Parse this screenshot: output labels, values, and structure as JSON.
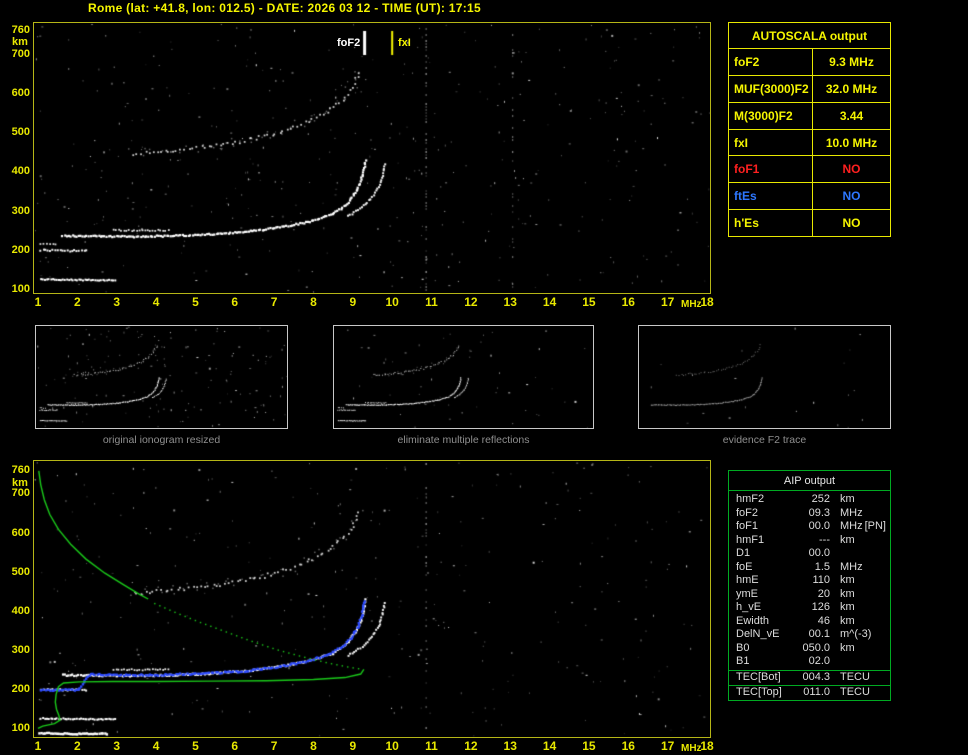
{
  "title": "Rome (lat: +41.8, lon: 012.5) - DATE: 2026 03 12 - TIME (UT): 17:15",
  "top_plot": {
    "fof2_label": "foF2",
    "fxi_label": "fxI",
    "y_unit": "km",
    "x_unit": "MHz"
  },
  "bottom_plot": {
    "y_unit": "km",
    "x_unit": "MHz"
  },
  "autoscala_table": {
    "title": "AUTOSCALA output",
    "rows": [
      {
        "label": "foF2",
        "value": "9.3 MHz",
        "color": "#f5f500"
      },
      {
        "label": "MUF(3000)F2",
        "value": "32.0 MHz",
        "color": "#f5f500"
      },
      {
        "label": "M(3000)F2",
        "value": "3.44",
        "color": "#f5f500"
      },
      {
        "label": "fxI",
        "value": "10.0 MHz",
        "color": "#f5f500"
      },
      {
        "label": "foF1",
        "value": "NO",
        "color": "#ff2020"
      },
      {
        "label": "ftEs",
        "value": "NO",
        "color": "#2e78ff"
      },
      {
        "label": "h'Es",
        "value": "NO",
        "color": "#f5f500"
      }
    ]
  },
  "thumbnails": [
    {
      "caption": "original ionogram resized",
      "noise_seed": 31,
      "noise_count": 150,
      "alpha": 1
    },
    {
      "caption": "eliminate multiple reflections",
      "noise_seed": 32,
      "noise_count": 55,
      "alpha": 1
    },
    {
      "caption": "evidence F2 trace",
      "noise_seed": 33,
      "noise_count": 20,
      "alpha": 0.55,
      "series": [
        "F2-trace-O",
        "second-hop"
      ]
    }
  ],
  "aip_table": {
    "title": "AIP output",
    "rows": [
      {
        "name": "hmF2",
        "value": "252",
        "unit": "km",
        "extra": ""
      },
      {
        "name": "foF2",
        "value": "09.3",
        "unit": "MHz",
        "extra": ""
      },
      {
        "name": "foF1",
        "value": "00.0",
        "unit": "MHz",
        "extra": "[PN]"
      },
      {
        "name": "hmF1",
        "value": "---",
        "unit": "km",
        "extra": ""
      },
      {
        "name": "D1",
        "value": "00.0",
        "unit": "",
        "extra": ""
      },
      {
        "name": "foE",
        "value": "1.5",
        "unit": "MHz",
        "extra": ""
      },
      {
        "name": "hmE",
        "value": "110",
        "unit": "km",
        "extra": ""
      },
      {
        "name": "ymE",
        "value": "20",
        "unit": "km",
        "extra": ""
      },
      {
        "name": "h_vE",
        "value": "126",
        "unit": "km",
        "extra": ""
      },
      {
        "name": "Ewidth",
        "value": "46",
        "unit": "km",
        "extra": ""
      },
      {
        "name": "DelN_vE",
        "value": "00.1",
        "unit": "m^(-3)",
        "extra": ""
      },
      {
        "name": "B0",
        "value": "050.0",
        "unit": "km",
        "extra": ""
      },
      {
        "name": "B1",
        "value": "02.0",
        "unit": "",
        "extra": ""
      }
    ],
    "tec_rows": [
      {
        "name": "TEC[Bot]",
        "value": "004.3",
        "unit": "TECU"
      },
      {
        "name": "TEC[Top]",
        "value": "011.0",
        "unit": "TECU"
      }
    ]
  },
  "chart_data": [
    {
      "type": "scatter",
      "title": "ionogram echoes (top panel)",
      "xlabel": "MHz",
      "ylabel": "km",
      "xlim": [
        1,
        18
      ],
      "ylim": [
        100,
        760
      ],
      "x_ticks": [
        1,
        2,
        3,
        4,
        5,
        6,
        7,
        8,
        9,
        10,
        11,
        12,
        13,
        14,
        15,
        16,
        17,
        18
      ],
      "y_ticks": [
        760,
        700,
        600,
        500,
        400,
        300,
        200,
        100
      ],
      "grid": false,
      "markers": {
        "foF2_MHz": 9.3,
        "fxI_MHz": 10.0
      },
      "noise": {
        "seed": 11,
        "count": 420
      },
      "streaks": [
        {
          "f": 10.85,
          "p": 0.5
        },
        {
          "f": 13.05,
          "p": 0.18
        }
      ],
      "series": [
        {
          "name": "F2-trace-O",
          "color": "#ffffff",
          "mode": "dots",
          "size": 2.2,
          "step": 2,
          "jitter": 0.7,
          "points": [
            [
              1.6,
              238
            ],
            [
              2.4,
              237
            ],
            [
              3.4,
              236
            ],
            [
              4.4,
              238
            ],
            [
              5.4,
              242
            ],
            [
              6.4,
              250
            ],
            [
              7.2,
              261
            ],
            [
              7.9,
              275
            ],
            [
              8.45,
              293
            ],
            [
              8.8,
              316
            ],
            [
              9.0,
              342
            ],
            [
              9.17,
              374
            ],
            [
              9.26,
              408
            ],
            [
              9.3,
              432
            ]
          ]
        },
        {
          "name": "F2-trace-X",
          "color": "#f0f0f0",
          "mode": "dots",
          "size": 2,
          "step": 2.4,
          "jitter": 0.7,
          "points": [
            [
              8.85,
              288
            ],
            [
              9.2,
              309
            ],
            [
              9.45,
              334
            ],
            [
              9.63,
              362
            ],
            [
              9.74,
              394
            ],
            [
              9.79,
              424
            ]
          ]
        },
        {
          "name": "F2-X-left",
          "color": "#e8e8e8",
          "mode": "dots",
          "size": 1.8,
          "step": 2.6,
          "jitter": 0.6,
          "points": [
            [
              2.9,
              252
            ],
            [
              3.6,
              251
            ],
            [
              4.3,
              252
            ]
          ]
        },
        {
          "name": "second-hop",
          "color": "#e0e0e0",
          "mode": "dots",
          "size": 1.8,
          "step": 4,
          "jitter": 1.8,
          "alpha": 0.9,
          "points": [
            [
              3.4,
              447
            ],
            [
              4.1,
              452
            ],
            [
              4.8,
              459
            ],
            [
              5.5,
              467
            ],
            [
              6.1,
              477
            ],
            [
              6.7,
              490
            ],
            [
              7.25,
              506
            ],
            [
              7.75,
              524
            ],
            [
              8.2,
              546
            ],
            [
              8.55,
              571
            ],
            [
              8.85,
              601
            ],
            [
              9.05,
              633
            ],
            [
              9.18,
              662
            ]
          ]
        },
        {
          "name": "hop-scatter",
          "color": "#bdbdbd",
          "mode": "dots",
          "size": 1.5,
          "step": 7,
          "jitter": 5,
          "alpha": 0.5,
          "points": [
            [
              3.4,
              447
            ],
            [
              4.8,
              459
            ],
            [
              6.1,
              477
            ],
            [
              7.25,
              506
            ],
            [
              8.2,
              546
            ],
            [
              8.85,
              601
            ],
            [
              9.18,
              662
            ]
          ]
        },
        {
          "name": "E-region-echo",
          "color": "#ffffff",
          "mode": "dots",
          "size": 2,
          "step": 2,
          "jitter": 0.5,
          "points": [
            [
              1.05,
              127
            ],
            [
              1.7,
              126
            ],
            [
              2.4,
              125
            ],
            [
              2.95,
              125
            ]
          ]
        },
        {
          "name": "low-freq-200",
          "color": "#f0f0f0",
          "mode": "dots",
          "size": 2,
          "step": 2.4,
          "jitter": 0.8,
          "points": [
            [
              1.05,
              201
            ],
            [
              1.6,
              200
            ],
            [
              2.25,
              200
            ]
          ]
        },
        {
          "name": "low-freq-215",
          "color": "#d8d8d8",
          "mode": "dots",
          "size": 1.8,
          "step": 3,
          "jitter": 0.8,
          "points": [
            [
              1.05,
              216
            ],
            [
              1.45,
              215
            ]
          ]
        }
      ]
    },
    {
      "type": "scatter",
      "title": "ionogram with restored trace and electron density profile (bottom panel)",
      "xlabel": "MHz",
      "ylabel": "km",
      "xlim": [
        1,
        18
      ],
      "ylim": [
        100,
        760
      ],
      "x_ticks": [
        1,
        2,
        3,
        4,
        5,
        6,
        7,
        8,
        9,
        10,
        11,
        12,
        13,
        14,
        15,
        16,
        17,
        18
      ],
      "y_ticks": [
        760,
        700,
        600,
        500,
        400,
        300,
        200,
        100
      ],
      "grid": false,
      "noise": {
        "seed": 23,
        "count": 320
      },
      "streaks": [
        {
          "f": 10.85,
          "p": 0.3
        }
      ],
      "series": [
        {
          "name": "F2-trace-O",
          "color": "#ffffff",
          "mode": "dots",
          "size": 2.2,
          "step": 2,
          "jitter": 0.7,
          "points": [
            [
              1.6,
              238
            ],
            [
              2.4,
              237
            ],
            [
              3.4,
              236
            ],
            [
              4.4,
              238
            ],
            [
              5.4,
              242
            ],
            [
              6.4,
              250
            ],
            [
              7.2,
              261
            ],
            [
              7.9,
              275
            ],
            [
              8.45,
              293
            ],
            [
              8.8,
              316
            ],
            [
              9.0,
              342
            ],
            [
              9.17,
              374
            ],
            [
              9.26,
              408
            ],
            [
              9.3,
              432
            ]
          ]
        },
        {
          "name": "F2-trace-X",
          "color": "#f0f0f0",
          "mode": "dots",
          "size": 2,
          "step": 2.4,
          "jitter": 0.7,
          "points": [
            [
              8.85,
              288
            ],
            [
              9.2,
              309
            ],
            [
              9.45,
              334
            ],
            [
              9.63,
              362
            ],
            [
              9.74,
              394
            ],
            [
              9.79,
              424
            ]
          ]
        },
        {
          "name": "F2-X-left",
          "color": "#e8e8e8",
          "mode": "dots",
          "size": 1.8,
          "step": 2.6,
          "jitter": 0.6,
          "points": [
            [
              2.9,
              252
            ],
            [
              3.6,
              251
            ],
            [
              4.3,
              252
            ]
          ]
        },
        {
          "name": "second-hop",
          "color": "#e0e0e0",
          "mode": "dots",
          "size": 1.8,
          "step": 4,
          "jitter": 1.8,
          "alpha": 0.9,
          "points": [
            [
              3.4,
              447
            ],
            [
              4.1,
              452
            ],
            [
              4.8,
              459
            ],
            [
              5.5,
              467
            ],
            [
              6.1,
              477
            ],
            [
              6.7,
              490
            ],
            [
              7.25,
              506
            ],
            [
              7.75,
              524
            ],
            [
              8.2,
              546
            ],
            [
              8.55,
              571
            ],
            [
              8.85,
              601
            ],
            [
              9.05,
              633
            ],
            [
              9.18,
              662
            ]
          ]
        },
        {
          "name": "hop-scatter",
          "color": "#bdbdbd",
          "mode": "dots",
          "size": 1.5,
          "step": 7,
          "jitter": 5,
          "alpha": 0.5,
          "points": [
            [
              3.4,
              447
            ],
            [
              4.8,
              459
            ],
            [
              6.1,
              477
            ],
            [
              7.25,
              506
            ],
            [
              8.2,
              546
            ],
            [
              8.85,
              601
            ],
            [
              9.18,
              662
            ]
          ]
        },
        {
          "name": "E-region-echo",
          "color": "#ffffff",
          "mode": "dots",
          "size": 2,
          "step": 2,
          "jitter": 0.5,
          "points": [
            [
              1.05,
              127
            ],
            [
              1.7,
              126
            ],
            [
              2.4,
              125
            ],
            [
              2.95,
              125
            ]
          ]
        },
        {
          "name": "baseline-echo",
          "color": "#ffffff",
          "mode": "dots",
          "size": 2.4,
          "step": 2,
          "jitter": 0.5,
          "points": [
            [
              1.0,
              90
            ],
            [
              1.8,
              88
            ],
            [
              2.75,
              88
            ]
          ]
        },
        {
          "name": "low-freq-200",
          "color": "#f0f0f0",
          "mode": "dots",
          "size": 2,
          "step": 2.4,
          "jitter": 0.8,
          "points": [
            [
              1.05,
              201
            ],
            [
              1.6,
              200
            ],
            [
              2.25,
              200
            ]
          ]
        },
        {
          "name": "restored-trace-blue",
          "color": "#2b49ff",
          "mode": "dots",
          "size": 2.4,
          "step": 2.2,
          "jitter": 0.8,
          "points": [
            [
              1.05,
              200
            ],
            [
              1.55,
              200
            ],
            [
              2.0,
              201
            ],
            [
              2.3,
              241
            ],
            [
              3.2,
              238
            ],
            [
              4.2,
              239
            ],
            [
              5.2,
              242
            ],
            [
              6.2,
              248
            ],
            [
              7.0,
              258
            ],
            [
              7.7,
              271
            ],
            [
              8.3,
              288
            ],
            [
              8.7,
              310
            ],
            [
              8.95,
              336
            ],
            [
              9.12,
              366
            ],
            [
              9.22,
              400
            ],
            [
              9.28,
              432
            ]
          ]
        },
        {
          "name": "profile-topside",
          "color": "#19c819",
          "mode": "line",
          "width": 1.4,
          "points": [
            [
              1.02,
              758
            ],
            [
              1.07,
              722
            ],
            [
              1.16,
              684
            ],
            [
              1.3,
              646
            ],
            [
              1.52,
              608
            ],
            [
              1.83,
              570
            ],
            [
              2.22,
              532
            ],
            [
              2.7,
              496
            ],
            [
              3.18,
              466
            ],
            [
              3.58,
              442
            ],
            [
              3.8,
              430
            ]
          ]
        },
        {
          "name": "profile-mid-dotted",
          "color": "#19c819",
          "mode": "dots",
          "size": 1.4,
          "step": 5.5,
          "jitter": 0,
          "points": [
            [
              3.95,
              420
            ],
            [
              4.5,
              396
            ],
            [
              5.1,
              372
            ],
            [
              5.75,
              348
            ],
            [
              6.4,
              324
            ],
            [
              7.05,
              302
            ],
            [
              7.7,
              284
            ],
            [
              8.35,
              268
            ],
            [
              8.9,
              257
            ],
            [
              9.22,
              252
            ]
          ]
        },
        {
          "name": "profile-bottomside",
          "color": "#19c819",
          "mode": "line",
          "width": 1.4,
          "points": [
            [
              9.28,
              250
            ],
            [
              9.2,
              238
            ],
            [
              8.8,
              229
            ],
            [
              8.0,
              224
            ],
            [
              6.8,
              221
            ],
            [
              5.4,
              220
            ],
            [
              4.0,
              219
            ],
            [
              2.9,
              219
            ],
            [
              2.05,
              218
            ],
            [
              1.65,
              215
            ],
            [
              1.52,
              206
            ],
            [
              1.46,
              186
            ],
            [
              1.44,
              166
            ],
            [
              1.47,
              148
            ],
            [
              1.53,
              132
            ],
            [
              1.56,
              120
            ],
            [
              1.42,
              111
            ],
            [
              1.12,
              105
            ],
            [
              1.0,
              99
            ]
          ]
        }
      ]
    }
  ]
}
